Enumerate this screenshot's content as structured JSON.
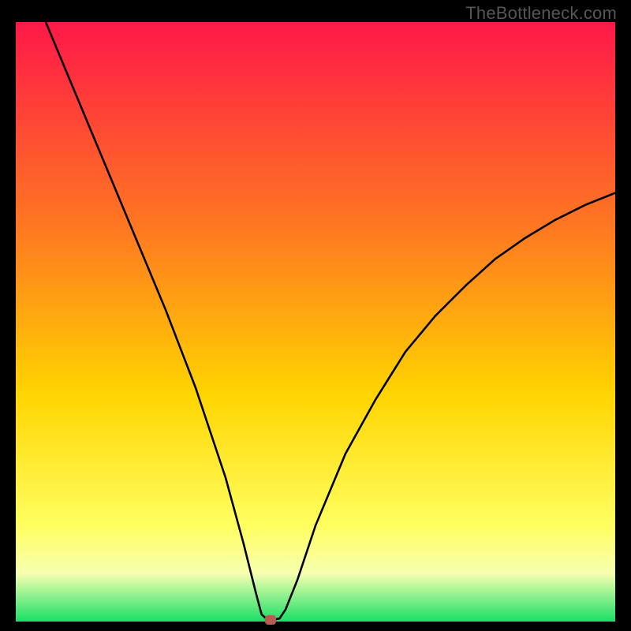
{
  "watermark": "TheBottleneck.com",
  "colors": {
    "frame_bg": "#000000",
    "curve": "#000000",
    "marker": "#b85b52",
    "gradient_top": "#ff1848",
    "gradient_mid1": "#ff7a20",
    "gradient_mid2": "#ffd400",
    "gradient_mid3": "#ffff60",
    "gradient_mid4": "#f6ffb0",
    "gradient_bottom": "#19e066"
  },
  "chart_data": {
    "type": "line",
    "title": "",
    "xlabel": "",
    "ylabel": "",
    "xlim": [
      0,
      100
    ],
    "ylim": [
      0,
      100
    ],
    "annotations": [],
    "series": [
      {
        "name": "bottleneck-curve",
        "x": [
          0,
          5,
          10,
          15,
          20,
          25,
          30,
          35,
          38,
          40,
          41,
          42,
          43,
          44,
          45,
          47,
          50,
          55,
          60,
          65,
          70,
          75,
          80,
          85,
          90,
          95,
          100
        ],
        "y": [
          null,
          100,
          88,
          76,
          64,
          52,
          39,
          24,
          13,
          5,
          1.2,
          0.3,
          0.3,
          0.5,
          2,
          7,
          16,
          28,
          37,
          45,
          51,
          56,
          60.5,
          64,
          67,
          69.5,
          71.5
        ]
      }
    ],
    "marker": {
      "x": 42.5,
      "y": 0.3
    },
    "background": {
      "type": "vertical-gradient",
      "stops": [
        {
          "offset": 0,
          "color": "#ff1848"
        },
        {
          "offset": 0.35,
          "color": "#ff7a20"
        },
        {
          "offset": 0.62,
          "color": "#ffd400"
        },
        {
          "offset": 0.84,
          "color": "#ffff60"
        },
        {
          "offset": 0.92,
          "color": "#f6ffb0"
        },
        {
          "offset": 1.0,
          "color": "#19e066"
        }
      ]
    }
  }
}
